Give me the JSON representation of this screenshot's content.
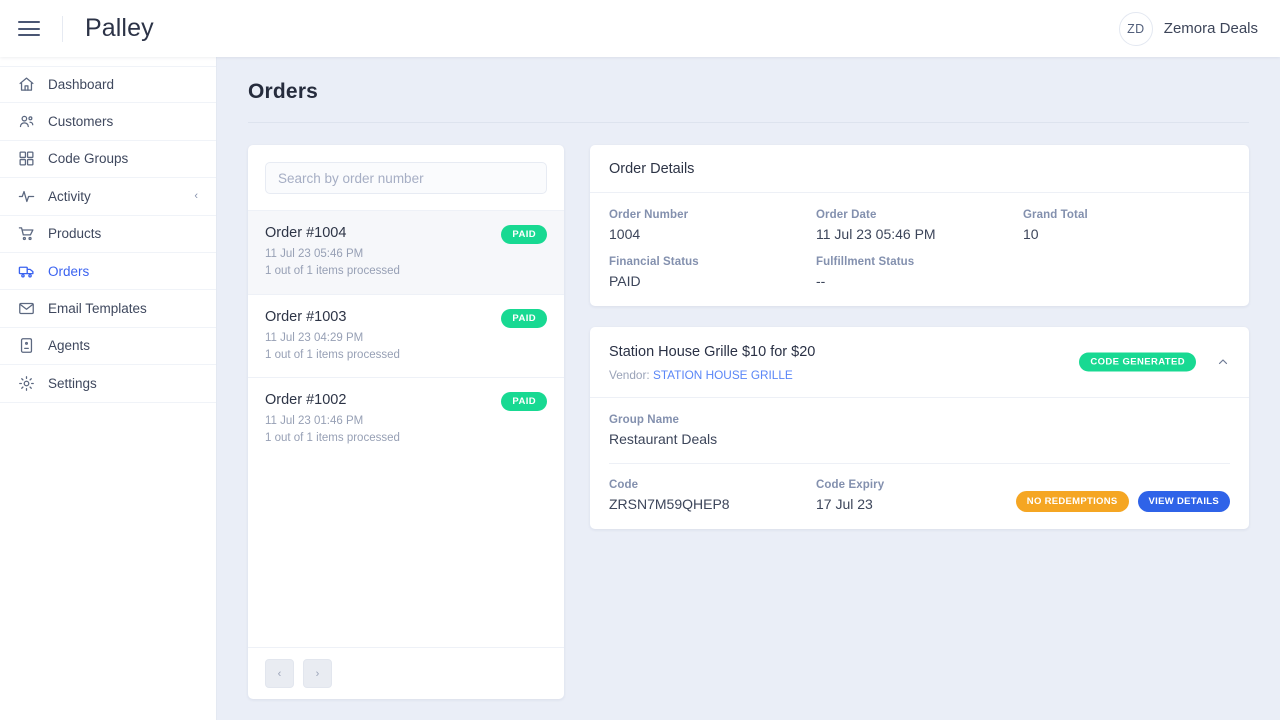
{
  "header": {
    "menu_icon": "hamburger-icon",
    "brand": "Palley",
    "avatar_initials": "ZD",
    "account_name": "Zemora Deals"
  },
  "sidebar": {
    "items": [
      {
        "label": "Dashboard",
        "icon": "home-icon",
        "active": false
      },
      {
        "label": "Customers",
        "icon": "users-icon",
        "active": false
      },
      {
        "label": "Code Groups",
        "icon": "grid-icon",
        "active": false
      },
      {
        "label": "Activity",
        "icon": "activity-icon",
        "active": false,
        "chevron": "‹"
      },
      {
        "label": "Products",
        "icon": "cart-icon",
        "active": false
      },
      {
        "label": "Orders",
        "icon": "truck-icon",
        "active": true
      },
      {
        "label": "Email Templates",
        "icon": "envelope-icon",
        "active": false
      },
      {
        "label": "Agents",
        "icon": "agent-icon",
        "active": false
      },
      {
        "label": "Settings",
        "icon": "gear-icon",
        "active": false
      }
    ]
  },
  "main": {
    "page_title": "Orders"
  },
  "orders_panel": {
    "search_placeholder": "Search by order number",
    "search_value": "",
    "items": [
      {
        "number": "Order #1004",
        "date": "11 Jul 23 05:46 PM",
        "processed": "1 out of 1 items processed",
        "status": "PAID",
        "selected": true
      },
      {
        "number": "Order #1003",
        "date": "11 Jul 23 04:29 PM",
        "processed": "1 out of 1 items processed",
        "status": "PAID",
        "selected": false
      },
      {
        "number": "Order #1002",
        "date": "11 Jul 23 01:46 PM",
        "processed": "1 out of 1 items processed",
        "status": "PAID",
        "selected": false
      }
    ],
    "pagination": {
      "prev_label": "‹",
      "next_label": "›"
    }
  },
  "order_details": {
    "title": "Order Details",
    "fields": [
      {
        "label": "Order Number",
        "value": "1004"
      },
      {
        "label": "Order Date",
        "value": "11 Jul 23 05:46 PM"
      },
      {
        "label": "Grand Total",
        "value": "10"
      },
      {
        "label": "Financial Status",
        "value": "PAID"
      },
      {
        "label": "Fulfillment Status",
        "value": "--"
      }
    ]
  },
  "product_card": {
    "title": "Station House Grille $10 for $20",
    "vendor_label": "Vendor:",
    "vendor_name": "STATION HOUSE GRILLE",
    "status_badge": "CODE GENERATED",
    "collapse_icon": "chevron-up-icon",
    "group_label": "Group Name",
    "group_value": "Restaurant Deals",
    "code_label": "Code",
    "code_value": "ZRSN7M59QHEP8",
    "expiry_label": "Code Expiry",
    "expiry_value": "17 Jul 23",
    "redemptions_pill": "NO REDEMPTIONS",
    "details_pill": "VIEW DETAILS"
  },
  "colors": {
    "page_bg": "#eaeef7",
    "accent_blue": "#3b63f0",
    "success_green": "#18d992",
    "warning_orange": "#f5a623",
    "info_blue": "#2f63e8",
    "label_muted": "#8390ae"
  }
}
